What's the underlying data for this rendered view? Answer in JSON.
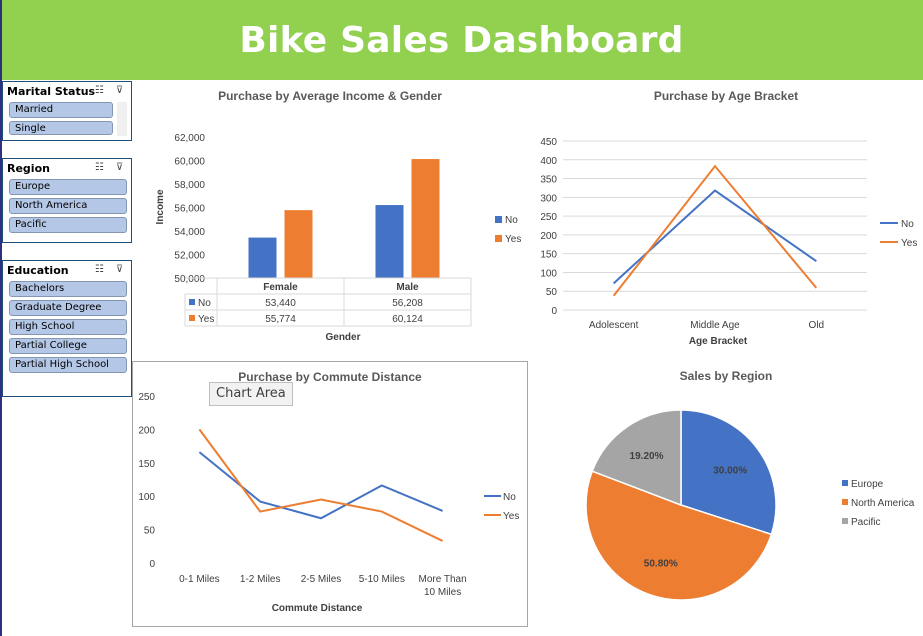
{
  "dashboard_title": "Bike Sales Dashboard",
  "colors": {
    "banner": "#92d050",
    "series_no": "#4472c4",
    "series_yes": "#ed7d31",
    "pacific": "#a5a5a5",
    "slicer_item": "#b4c7e7"
  },
  "slicers": [
    {
      "title": "Marital Status",
      "items": [
        "Married",
        "Single"
      ]
    },
    {
      "title": "Region",
      "items": [
        "Europe",
        "North America",
        "Pacific"
      ]
    },
    {
      "title": "Education",
      "items": [
        "Bachelors",
        "Graduate Degree",
        "High School",
        "Partial College",
        "Partial High School"
      ]
    }
  ],
  "slicer_icons": [
    "multi-select-icon",
    "clear-filter-icon"
  ],
  "tooltip": "Chart Area",
  "chart_data": [
    {
      "type": "bar",
      "title": "Purchase by Average Income & Gender",
      "categories": [
        "Female",
        "Male"
      ],
      "series": [
        {
          "name": "No",
          "values": [
            53440,
            56208
          ],
          "labels": [
            "53,440",
            "56,208"
          ]
        },
        {
          "name": "Yes",
          "values": [
            55774,
            60124
          ],
          "labels": [
            "55,774",
            "60,124"
          ]
        }
      ],
      "xlabel": "Gender",
      "ylabel": "Income",
      "ylim": [
        50000,
        62000
      ],
      "yticks": [
        "50,000",
        "52,000",
        "54,000",
        "56,000",
        "58,000",
        "60,000",
        "62,000"
      ],
      "legend": "right",
      "data_table": true
    },
    {
      "type": "line",
      "title": "Purchase by Age Bracket",
      "categories": [
        "Adolescent",
        "Middle Age",
        "Old"
      ],
      "series": [
        {
          "name": "No",
          "values": [
            71,
            318,
            130
          ]
        },
        {
          "name": "Yes",
          "values": [
            38,
            383,
            59
          ]
        }
      ],
      "xlabel": "Age Bracket",
      "ylabel": "",
      "ylim": [
        0,
        450
      ],
      "yticks": [
        "0",
        "50",
        "100",
        "150",
        "200",
        "250",
        "300",
        "350",
        "400",
        "450"
      ],
      "grid": true,
      "legend": "right"
    },
    {
      "type": "line",
      "title": "Purchase by Commute Distance",
      "categories": [
        "0-1 Miles",
        "1-2 Miles",
        "2-5 Miles",
        "5-10 Miles",
        "More Than 10 Miles"
      ],
      "series": [
        {
          "name": "No",
          "values": [
            166,
            92,
            67,
            116,
            78
          ]
        },
        {
          "name": "Yes",
          "values": [
            200,
            77,
            95,
            77,
            33
          ]
        }
      ],
      "xlabel": "Commute Distance",
      "ylabel": "",
      "ylim": [
        0,
        250
      ],
      "yticks": [
        "0",
        "50",
        "100",
        "150",
        "200",
        "250"
      ],
      "grid": false,
      "legend": "right"
    },
    {
      "type": "pie",
      "title": "Sales by Region",
      "categories": [
        "Europe",
        "North America",
        "Pacific"
      ],
      "values": [
        30.0,
        50.8,
        19.2
      ],
      "labels": [
        "30.00%",
        "50.80%",
        "19.20%"
      ],
      "legend": "right"
    }
  ]
}
